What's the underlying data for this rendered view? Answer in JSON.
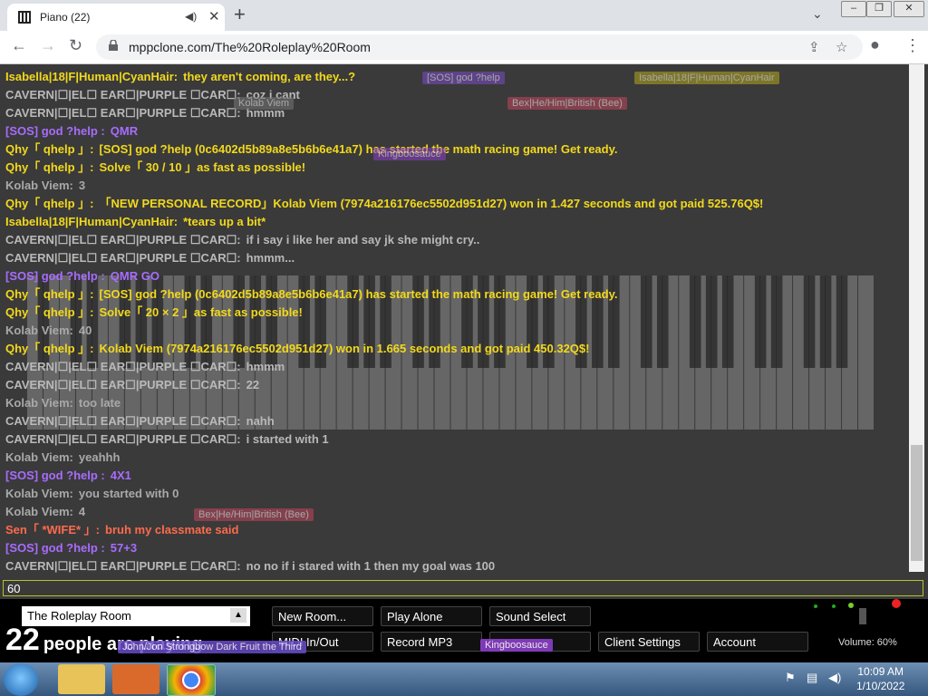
{
  "browser": {
    "tab_title": "Piano (22)",
    "url": "mppclone.com/The%20Roleplay%20Room"
  },
  "chat": [
    {
      "name": "Isabella|18|F|Human|CyanHair:",
      "text": "they aren't coming, are they...?",
      "color": "#f2d91c"
    },
    {
      "name": "CAVERN|☐|EL☐ EAR☐|PURPLE ☐CAR☐:",
      "text": "coz i cant",
      "color": "#b9b9b9"
    },
    {
      "name": "CAVERN|☐|EL☐ EAR☐|PURPLE ☐CAR☐:",
      "text": "hmmm",
      "color": "#b9b9b9"
    },
    {
      "name": "[SOS] god ?help :",
      "text": "QMR",
      "color": "#a86cff"
    },
    {
      "name": "Qhy「 qhelp 」:",
      "text": "[SOS] god ?help (0c6402d5b89a8e5b6b6e41a7) has started the math racing game! Get ready.",
      "color": "#f2d91c"
    },
    {
      "name": "Qhy「 qhelp 」:",
      "text": "Solve「 30 / 10 」as fast as possible!",
      "color": "#f2d91c"
    },
    {
      "name": "Kolab Viem:",
      "text": "3",
      "color": "#a9a9a9"
    },
    {
      "name": "Qhy「 qhelp 」:",
      "text": "「NEW PERSONAL RECORD」Kolab Viem (7974a216176ec5502d951d27) won in 1.427 seconds and got paid 525.76Q$!",
      "color": "#f2d91c"
    },
    {
      "name": "Isabella|18|F|Human|CyanHair:",
      "text": "*tears up a bit*",
      "color": "#f2d91c"
    },
    {
      "name": "CAVERN|☐|EL☐ EAR☐|PURPLE ☐CAR☐:",
      "text": "if i say i like her and say jk she might cry..",
      "color": "#b9b9b9"
    },
    {
      "name": "CAVERN|☐|EL☐ EAR☐|PURPLE ☐CAR☐:",
      "text": "hmmm...",
      "color": "#b9b9b9"
    },
    {
      "name": "[SOS] god ?help :",
      "text": "QMR GO",
      "color": "#a86cff"
    },
    {
      "name": "Qhy「 qhelp 」:",
      "text": "[SOS] god ?help (0c6402d5b89a8e5b6b6e41a7) has started the math racing game! Get ready.",
      "color": "#f2d91c"
    },
    {
      "name": "Qhy「 qhelp 」:",
      "text": "Solve「 20 × 2 」as fast as possible!",
      "color": "#f2d91c"
    },
    {
      "name": "Kolab Viem:",
      "text": "40",
      "color": "#a9a9a9"
    },
    {
      "name": "Qhy「 qhelp 」:",
      "text": "Kolab Viem (7974a216176ec5502d951d27) won in 1.665 seconds and got paid 450.32Q$!",
      "color": "#f2d91c"
    },
    {
      "name": "CAVERN|☐|EL☐ EAR☐|PURPLE ☐CAR☐:",
      "text": "hmmm",
      "color": "#b9b9b9"
    },
    {
      "name": "CAVERN|☐|EL☐ EAR☐|PURPLE ☐CAR☐:",
      "text": "22",
      "color": "#b9b9b9"
    },
    {
      "name": "Kolab Viem:",
      "text": "too late",
      "color": "#a9a9a9"
    },
    {
      "name": "CAVERN|☐|EL☐ EAR☐|PURPLE ☐CAR☐:",
      "text": "nahh",
      "color": "#b9b9b9"
    },
    {
      "name": "CAVERN|☐|EL☐ EAR☐|PURPLE ☐CAR☐:",
      "text": "i started with 1",
      "color": "#b9b9b9"
    },
    {
      "name": "Kolab Viem:",
      "text": "yeahhh",
      "color": "#a9a9a9"
    },
    {
      "name": "[SOS] god ?help :",
      "text": "4X1",
      "color": "#a86cff"
    },
    {
      "name": "Kolab Viem:",
      "text": "you started with 0",
      "color": "#a9a9a9"
    },
    {
      "name": "Kolab Viem:",
      "text": "4",
      "color": "#a9a9a9"
    },
    {
      "name": "Sen「 *WIFE* 」:",
      "text": "bruh my classmate said",
      "color": "#ff6a4d"
    },
    {
      "name": "[SOS] god ?help :",
      "text": "57+3",
      "color": "#a86cff"
    },
    {
      "name": "CAVERN|☐|EL☐ EAR☐|PURPLE ☐CAR☐:",
      "text": "no no if i stared with 1 then my goal was 100",
      "color": "#b9b9b9"
    }
  ],
  "overlays": [
    {
      "text": "[SOS] god ?help",
      "bg": "#7a4cc9"
    },
    {
      "text": "Isabella|18|F|Human|CyanHair",
      "bg": "#b5a81c"
    },
    {
      "text": "Bex|He/Him|British (Bee)",
      "bg": "#c2455c"
    },
    {
      "text": "Kolab Viem",
      "bg": "#777777"
    },
    {
      "text": "Kingboosauce",
      "bg": "#8b3fc9"
    },
    {
      "text": "John/Jon Strongbow Dark Fruit the Third",
      "bg": "#6a4cc9"
    }
  ],
  "chat_input": {
    "value": "60"
  },
  "controls": {
    "room": "The Roleplay Room",
    "new_room": "New Room...",
    "play_alone": "Play Alone",
    "sound_select": "Sound Select",
    "midi": "MIDI In/Out",
    "record": "Record MP3",
    "client_settings": "Client Settings",
    "account": "Account",
    "player_count": "22",
    "player_label": "people are playing",
    "volume": "Volume: 60%"
  },
  "taskbar": {
    "time": "10:09 AM",
    "date": "1/10/2022"
  }
}
